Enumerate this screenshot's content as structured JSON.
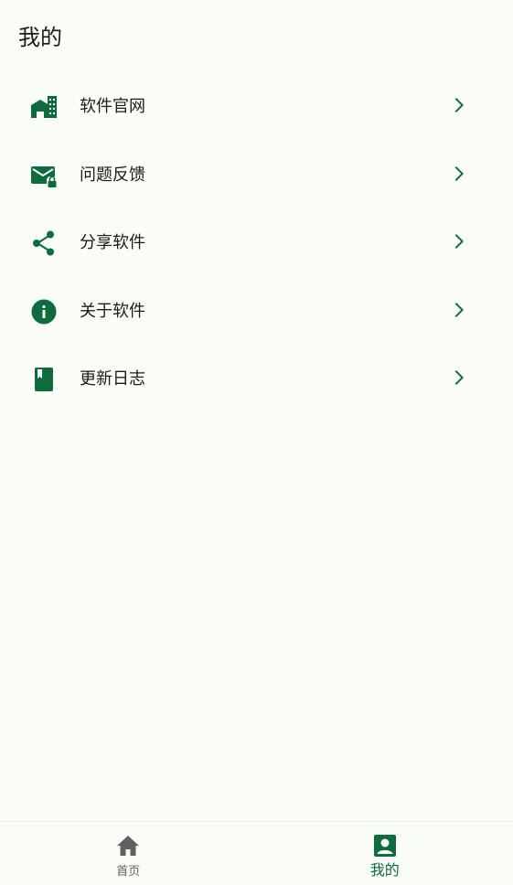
{
  "header": {
    "title": "我的"
  },
  "menu": {
    "items": [
      {
        "label": "软件官网",
        "icon": "apartment-icon"
      },
      {
        "label": "问题反馈",
        "icon": "mail-lock-icon"
      },
      {
        "label": "分享软件",
        "icon": "share-icon"
      },
      {
        "label": "关于软件",
        "icon": "info-icon"
      },
      {
        "label": "更新日志",
        "icon": "book-bookmark-icon"
      }
    ]
  },
  "bottom_nav": {
    "home": {
      "label": "首页",
      "icon": "home-icon",
      "active": false
    },
    "mine": {
      "label": "我的",
      "icon": "account-box-icon",
      "active": true
    }
  },
  "colors": {
    "accent": "#0e6b3d",
    "background": "#fbfdf8",
    "text": "#1a1c19",
    "inactive": "#5f625e"
  }
}
